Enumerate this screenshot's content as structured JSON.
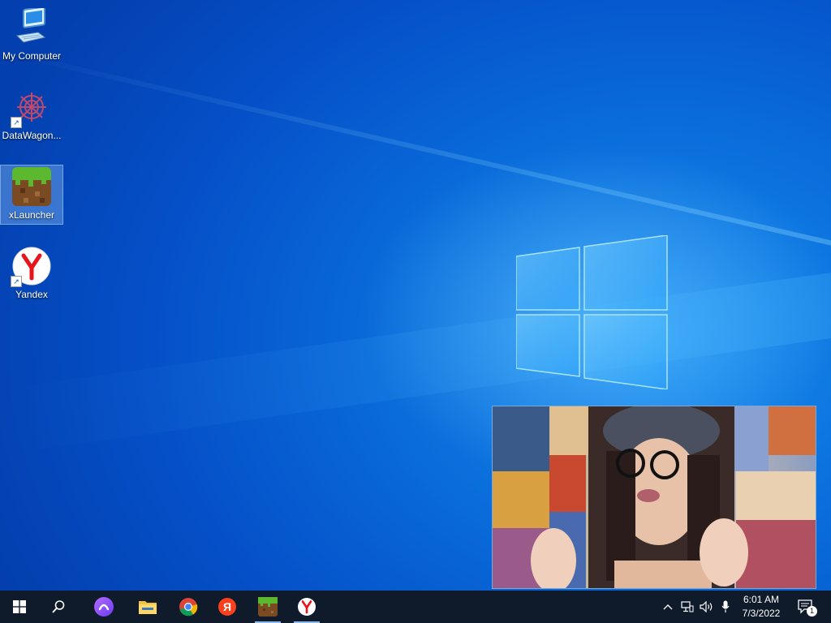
{
  "desktop": {
    "icons": [
      {
        "label": "My Computer",
        "icon": "computer-icon"
      },
      {
        "label": "DataWagon...",
        "icon": "datawagon-icon",
        "shortcut": true
      },
      {
        "label": "xLauncher",
        "icon": "minecraft-grass-block-icon",
        "selected": true
      },
      {
        "label": "Yandex",
        "icon": "yandex-browser-icon",
        "shortcut": true
      }
    ],
    "wallpaper": "windows-10-default",
    "popup": {
      "type": "video",
      "content": "vlogger-video-thumbnail"
    }
  },
  "taskbar": {
    "start_icon": "windows-start-icon",
    "search_icon": "search-icon",
    "pinned": [
      {
        "icon": "alice-assistant-icon",
        "running": false
      },
      {
        "icon": "file-explorer-icon",
        "running": false
      },
      {
        "icon": "chrome-icon",
        "running": false
      },
      {
        "icon": "yandex-icon",
        "running": false
      },
      {
        "icon": "minecraft-icon",
        "running": true
      },
      {
        "icon": "yandex-browser-icon",
        "running": true
      }
    ],
    "tray": {
      "icons": [
        "chevron-up-icon",
        "network-icon",
        "volume-icon",
        "microphone-icon"
      ],
      "time": "6:01 AM",
      "date": "7/3/2022",
      "notification_count": "1"
    }
  },
  "colors": {
    "accent": "#0a6fdc",
    "taskbar": "#0f1a2a",
    "yandex_red": "#ff0000"
  }
}
